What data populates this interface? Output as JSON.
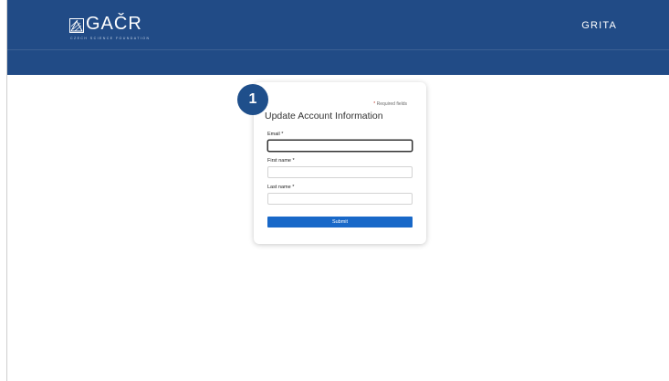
{
  "header": {
    "logo_text": "GAČR",
    "logo_subtitle": "CZECH SCIENCE FOUNDATION",
    "app_name": "GRITA",
    "background": "#214b86"
  },
  "step_badge": {
    "label": "1",
    "color": "#1f4f8b"
  },
  "form": {
    "required_note_star": "*",
    "required_note": "Required fields",
    "title": "Update Account Information",
    "fields": [
      {
        "label": "Email *",
        "value": "",
        "focused": true
      },
      {
        "label": "First name *",
        "value": "",
        "focused": false
      },
      {
        "label": "Last name *",
        "value": "",
        "focused": false
      }
    ],
    "submit_label": "Submit",
    "submit_color": "#1868c8"
  }
}
